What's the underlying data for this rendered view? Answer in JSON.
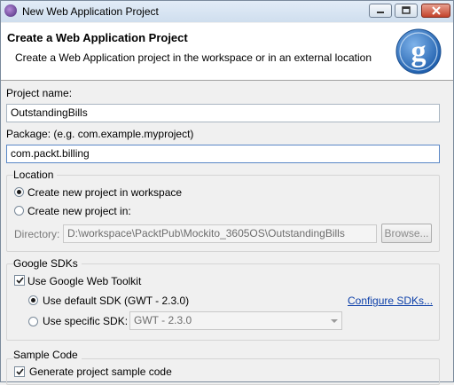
{
  "window": {
    "title": "New Web Application Project",
    "controls": {
      "minimize": "minimize-icon",
      "maximize": "maximize-icon",
      "close": "close-icon"
    }
  },
  "banner": {
    "title": "Create a Web Application Project",
    "description": "Create a Web Application project in the workspace or in an external location",
    "logo_icon": "google-g-icon"
  },
  "project": {
    "name_label": "Project name:",
    "name_value": "OutstandingBills",
    "package_label": "Package: (e.g. com.example.myproject)",
    "package_value": "com.packt.billing"
  },
  "location": {
    "title": "Location",
    "option_workspace": "Create new project in workspace",
    "option_in": "Create new project in:",
    "selected": "workspace",
    "directory_label": "Directory:",
    "directory_value": "D:\\workspace\\PacktPub\\Mockito_3605OS\\OutstandingBills",
    "browse_label": "Browse..."
  },
  "google_sdks": {
    "title": "Google SDKs",
    "use_gwt_label": "Use Google Web Toolkit",
    "use_gwt_checked": true,
    "default_sdk_label": "Use default SDK (GWT - 2.3.0)",
    "specific_sdk_label": "Use specific SDK:",
    "selected": "default",
    "specific_sdk_value": "GWT - 2.3.0",
    "configure_link": "Configure SDKs..."
  },
  "sample_code": {
    "title": "Sample Code",
    "generate_label": "Generate project sample code",
    "generate_checked": true
  }
}
